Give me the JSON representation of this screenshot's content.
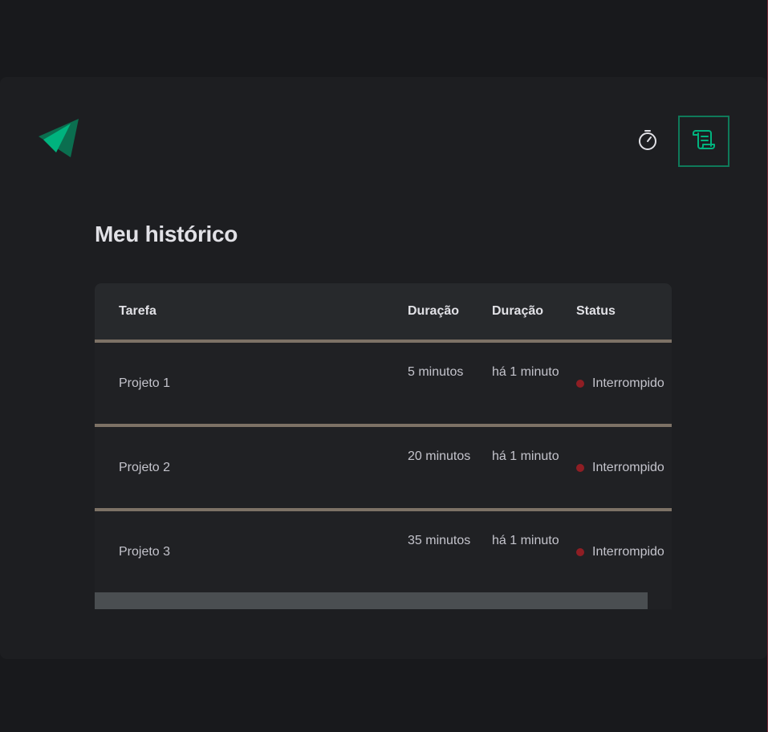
{
  "header": {
    "logo_icon": "triangle-logo-icon",
    "nav": {
      "timer_icon": "stopwatch-icon",
      "history_icon": "scroll-icon",
      "active": "history",
      "accent_color": "#0f7a5a",
      "icon_active_color": "#00b37e"
    }
  },
  "main": {
    "title": "Meu histórico",
    "table": {
      "columns": [
        "Tarefa",
        "Duração",
        "Duração",
        "Status"
      ],
      "rows": [
        {
          "task": "Projeto 1",
          "duration": "5 minutos",
          "started": "há 1 minuto",
          "status": "Interrompido",
          "status_color": "#8f1e24"
        },
        {
          "task": "Projeto 2",
          "duration": "20 minutos",
          "started": "há 1 minuto",
          "status": "Interrompido",
          "status_color": "#8f1e24"
        },
        {
          "task": "Projeto 3",
          "duration": "35 minutos",
          "started": "há 1 minuto",
          "status": "Interrompido",
          "status_color": "#8f1e24"
        }
      ]
    }
  },
  "colors": {
    "background": "#18191c",
    "card": "#1d1e21",
    "table_header": "#27292c",
    "row_bg": "#202124",
    "row_separator": "#7d7266",
    "title_text": "#e1e1e6",
    "body_text": "#c4c4cc"
  }
}
